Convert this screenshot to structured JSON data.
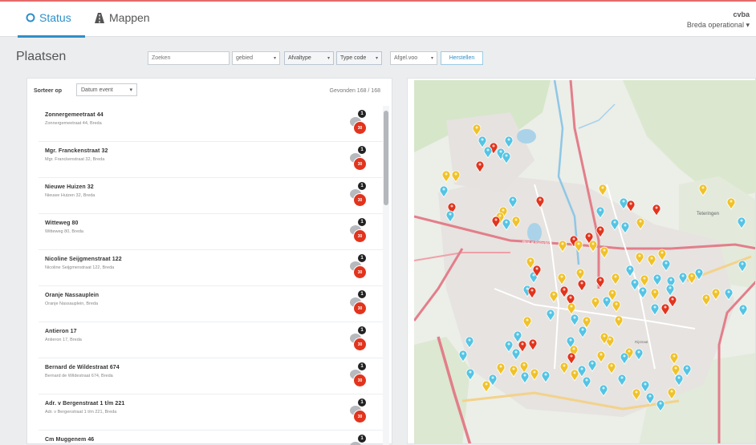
{
  "nav": {
    "tabs": [
      {
        "label": "Status",
        "icon": "circle-icon",
        "active": true
      },
      {
        "label": "Mappen",
        "icon": "road-icon",
        "active": false
      }
    ],
    "user": {
      "name": "cvba",
      "role": "Breda operational"
    }
  },
  "colors": {
    "accent": "#2e8fc7",
    "top_border": "#e46a6a",
    "marker_red": "#e2341d",
    "marker_yellow": "#f0c22a",
    "marker_blue": "#55c4e4"
  },
  "page": {
    "title": "Plaatsen"
  },
  "filters": {
    "search_placeholder": "Zoeken",
    "gebied": "gebied",
    "afvaltype": "Afvaltype",
    "typecode": "Type code",
    "afgelezen": "Afgel.voo",
    "reset": "Herstellen"
  },
  "list": {
    "sort_label": "Sorteer op",
    "sort_value": "Datum event",
    "count": "Gevonden 168 / 168",
    "items": [
      {
        "title": "Zonnergemeetraat 44",
        "sub": "Zonnergemeetraat 44, Breda",
        "alerts": "1",
        "value": "30"
      },
      {
        "title": "Mgr. Franckenstraat 32",
        "sub": "Mgr. Franckenstraat 32, Breda",
        "alerts": "1",
        "value": "30"
      },
      {
        "title": "Nieuwe Huizen 32",
        "sub": "Nieuwe Huizen 32, Breda",
        "alerts": "1",
        "value": "30"
      },
      {
        "title": "Witteweg 80",
        "sub": "Witteweg 80, Breda",
        "alerts": "1",
        "value": "30"
      },
      {
        "title": "Nicoline Seijgmenstraat 122",
        "sub": "Nicoline Seijgmenstraat 122, Breda",
        "alerts": "1",
        "value": "30"
      },
      {
        "title": "Oranje Nassauplein",
        "sub": "Oranje Nassauplein, Breda",
        "alerts": "1",
        "value": "30"
      },
      {
        "title": "Antieron 17",
        "sub": "Antieron 17, Breda",
        "alerts": "1",
        "value": "30"
      },
      {
        "title": "Bernard de Wildestraat 674",
        "sub": "Bernard de Wildestraat 674, Breda",
        "alerts": "1",
        "value": "30"
      },
      {
        "title": "Adr. v Bergenstraat 1 t/m 221",
        "sub": "Adr. v Bergenstraat 1 t/m 221, Breda",
        "alerts": "1",
        "value": "30"
      },
      {
        "title": "Cm Muggenem 46",
        "sub": "Cm Muggenem 46, Breda",
        "alerts": "1",
        "value": "30"
      }
    ]
  },
  "map": {
    "labels": [
      "Teteringen"
    ],
    "road_labels": [
      "Ring at Ruiterfeld",
      "Rijstraat"
    ]
  }
}
